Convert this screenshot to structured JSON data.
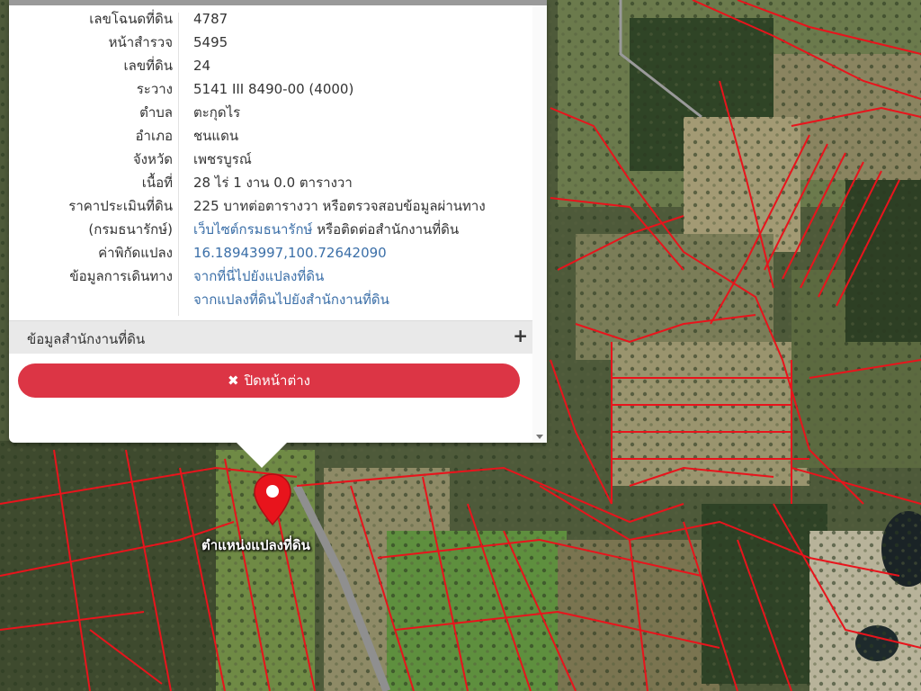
{
  "parcel_info": {
    "rows": [
      {
        "key": "เลขโฉนดที่ดิน",
        "value": "4787"
      },
      {
        "key": "หน้าสำรวจ",
        "value": "5495"
      },
      {
        "key": "เลขที่ดิน",
        "value": "24"
      },
      {
        "key": "ระวาง",
        "value": "5141 III 8490-00 (4000)"
      },
      {
        "key": "ตำบล",
        "value": "ตะกุดไร"
      },
      {
        "key": "อำเภอ",
        "value": "ชนแดน"
      },
      {
        "key": "จังหวัด",
        "value": "เพชรบูรณ์"
      },
      {
        "key": "เนื้อที่",
        "value": "28 ไร่ 1 งาน 0.0 ตารางวา"
      }
    ],
    "price": {
      "key_line1": "ราคาประเมินที่ดิน",
      "key_line2": "(กรมธนารักษ์)",
      "value_line1": "225 บาทต่อตารางวา หรือตรวจสอบข้อมูลผ่านทาง",
      "value_line2_link": "เว็บไซต์กรมธนารักษ์",
      "value_line2_rest": " หรือติดต่อสำนักงานที่ดิน"
    },
    "coordinates": {
      "key": "ค่าพิกัดแปลง",
      "value": "16.18943997,100.72642090"
    },
    "travel": {
      "key": "ข้อมูลการเดินทาง",
      "link1": "จากที่นี่ไปยังแปลงที่ดิน",
      "link2": "จากแปลงที่ดินไปยังสำนักงานที่ดิน"
    }
  },
  "office_section": {
    "label": "ข้อมูลสำนักงานที่ดิน",
    "toggle": "+"
  },
  "close_button": {
    "icon": "✖",
    "label": "ปิดหน้าต่าง"
  },
  "map": {
    "marker_label": "ตำแหน่งแปลงที่ดิน",
    "marker_icon": "map-pin-icon"
  },
  "colors": {
    "parcel_line": "#e8141c",
    "button": "#dc3545",
    "link": "#3b6fa8"
  }
}
